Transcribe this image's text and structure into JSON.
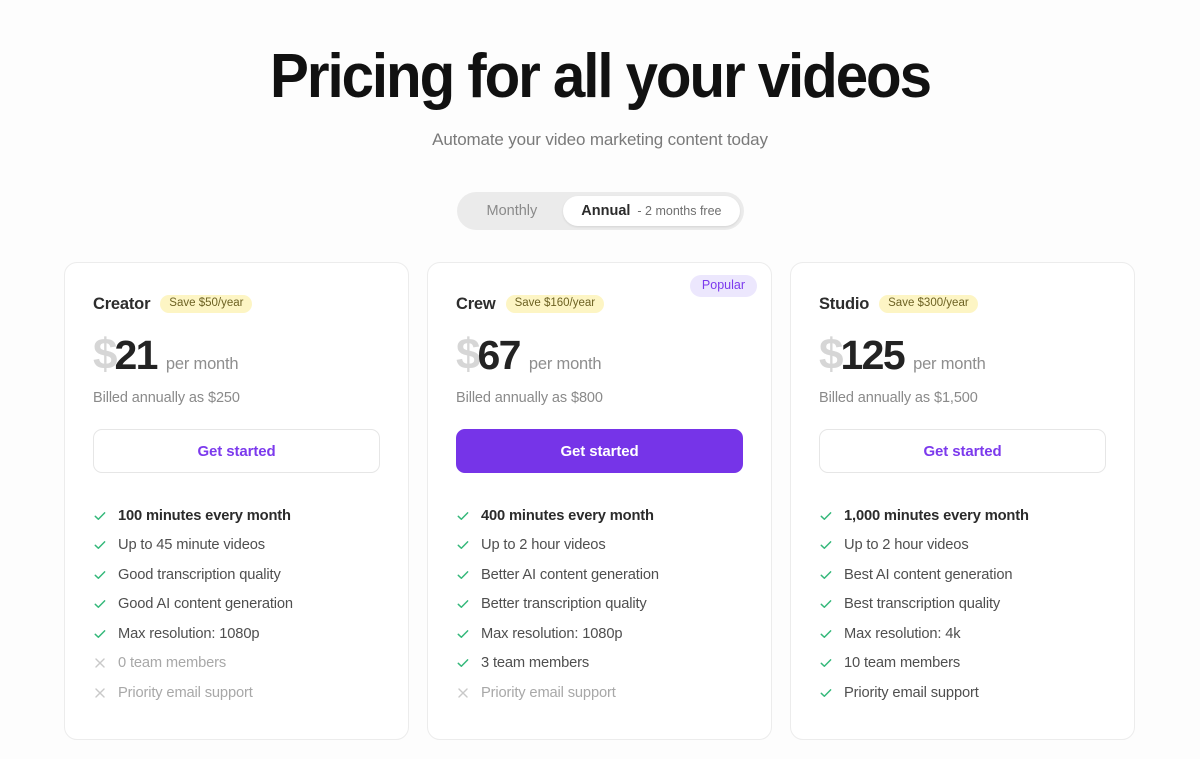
{
  "header": {
    "title": "Pricing for all your videos",
    "subtitle": "Automate your video marketing content today"
  },
  "billing_toggle": {
    "monthly_label": "Monthly",
    "annual_label": "Annual",
    "annual_note": "- 2 months free",
    "selected": "Annual"
  },
  "colors": {
    "accent_purple": "#7634e8",
    "badge_purple_bg": "#ece7fd",
    "badge_yellow_bg": "#fdf5c4",
    "check_green": "#34b87a",
    "cross_grey": "#c9c9c9"
  },
  "plans": [
    {
      "name": "Creator",
      "save_badge": "Save $50/year",
      "popular_badge": null,
      "currency": "$",
      "amount": "21",
      "per": "per month",
      "billed": "Billed annually as $250",
      "cta_label": "Get started",
      "cta_style": "outline",
      "features": [
        {
          "icon": "check-icon",
          "label": "100 minutes every month",
          "included": true,
          "emphasis": true
        },
        {
          "icon": "check-icon",
          "label": "Up to 45 minute videos",
          "included": true,
          "emphasis": false
        },
        {
          "icon": "check-icon",
          "label": "Good transcription quality",
          "included": true,
          "emphasis": false
        },
        {
          "icon": "check-icon",
          "label": "Good AI content generation",
          "included": true,
          "emphasis": false
        },
        {
          "icon": "check-icon",
          "label": "Max resolution: 1080p",
          "included": true,
          "emphasis": false
        },
        {
          "icon": "cross-icon",
          "label": "0 team members",
          "included": false,
          "emphasis": false
        },
        {
          "icon": "cross-icon",
          "label": "Priority email support",
          "included": false,
          "emphasis": false
        }
      ]
    },
    {
      "name": "Crew",
      "save_badge": "Save $160/year",
      "popular_badge": "Popular",
      "currency": "$",
      "amount": "67",
      "per": "per month",
      "billed": "Billed annually as $800",
      "cta_label": "Get started",
      "cta_style": "primary",
      "features": [
        {
          "icon": "check-icon",
          "label": "400 minutes every month",
          "included": true,
          "emphasis": true
        },
        {
          "icon": "check-icon",
          "label": "Up to 2 hour videos",
          "included": true,
          "emphasis": false
        },
        {
          "icon": "check-icon",
          "label": "Better AI content generation",
          "included": true,
          "emphasis": false
        },
        {
          "icon": "check-icon",
          "label": "Better transcription quality",
          "included": true,
          "emphasis": false
        },
        {
          "icon": "check-icon",
          "label": "Max resolution: 1080p",
          "included": true,
          "emphasis": false
        },
        {
          "icon": "check-icon",
          "label": "3 team members",
          "included": true,
          "emphasis": false
        },
        {
          "icon": "cross-icon",
          "label": "Priority email support",
          "included": false,
          "emphasis": false
        }
      ]
    },
    {
      "name": "Studio",
      "save_badge": "Save $300/year",
      "popular_badge": null,
      "currency": "$",
      "amount": "125",
      "per": "per month",
      "billed": "Billed annually as $1,500",
      "cta_label": "Get started",
      "cta_style": "outline",
      "features": [
        {
          "icon": "check-icon",
          "label": "1,000 minutes every month",
          "included": true,
          "emphasis": true
        },
        {
          "icon": "check-icon",
          "label": "Up to 2 hour videos",
          "included": true,
          "emphasis": false
        },
        {
          "icon": "check-icon",
          "label": "Best AI content generation",
          "included": true,
          "emphasis": false
        },
        {
          "icon": "check-icon",
          "label": "Best transcription quality",
          "included": true,
          "emphasis": false
        },
        {
          "icon": "check-icon",
          "label": "Max resolution: 4k",
          "included": true,
          "emphasis": false
        },
        {
          "icon": "check-icon",
          "label": "10 team members",
          "included": true,
          "emphasis": false
        },
        {
          "icon": "check-icon",
          "label": "Priority email support",
          "included": true,
          "emphasis": false
        }
      ]
    }
  ]
}
